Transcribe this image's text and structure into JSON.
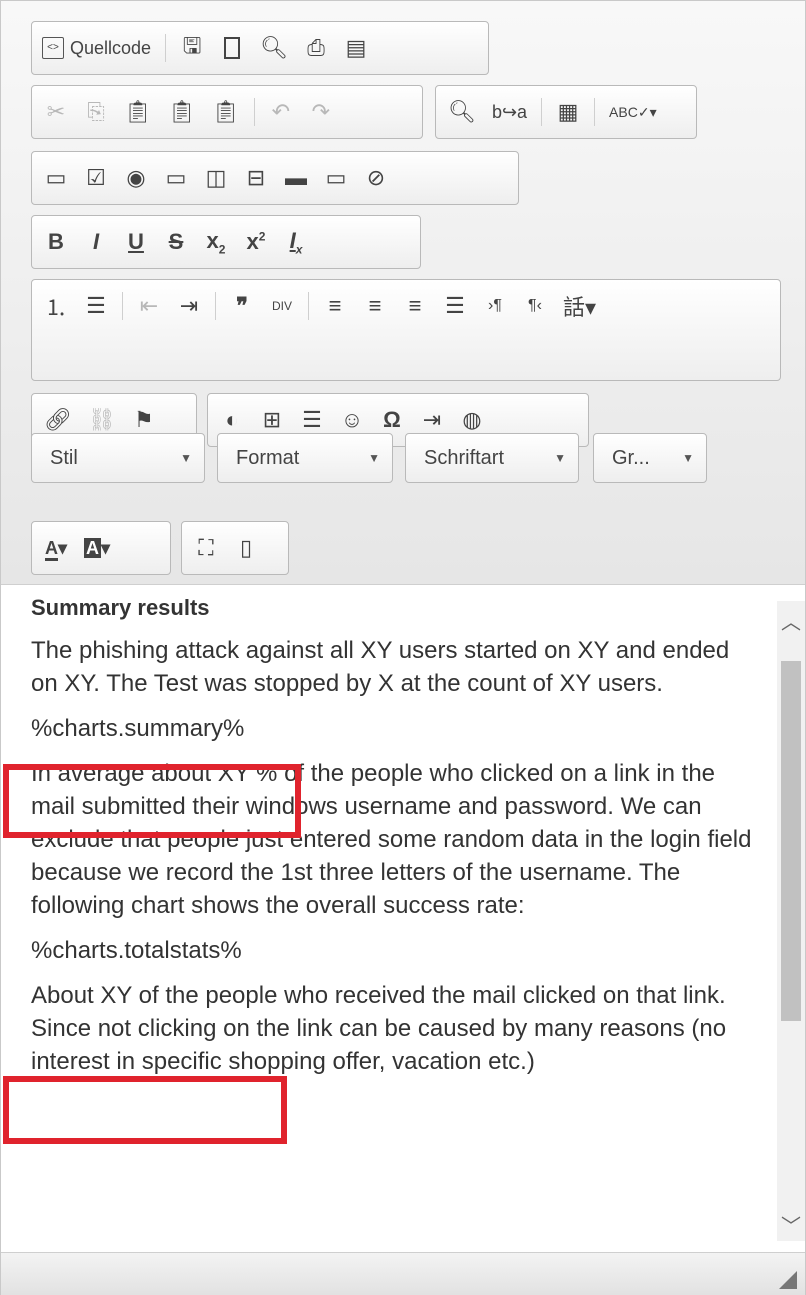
{
  "toolbar": {
    "source_label": "Quellcode",
    "format_select_styles": "Stil",
    "format_select_format": "Format",
    "format_select_font": "Schriftart",
    "format_select_size": "Gr..."
  },
  "content": {
    "heading": "Summary results",
    "p1": "The phishing attack against all XY users started on XY and ended on XY. The Test was stopped by X at the count of XY users.",
    "placeholder1": "%charts.summary%",
    "p2": "In average about XY % of the people who clicked on a link in the mail submitted their windows username and password. We can exclude that people just entered some random data in the login field because we record the 1st three letters of the username. The following chart shows the overall success rate:",
    "placeholder2": "%charts.totalstats%",
    "p3": "About XY of the people who received the mail clicked on that link. Since not clicking on the link can be caused by many reasons (no interest in specific shopping offer, vacation etc.)"
  },
  "colors": {
    "highlight": "#e0232d",
    "toolbar_bg": "#ececec"
  }
}
